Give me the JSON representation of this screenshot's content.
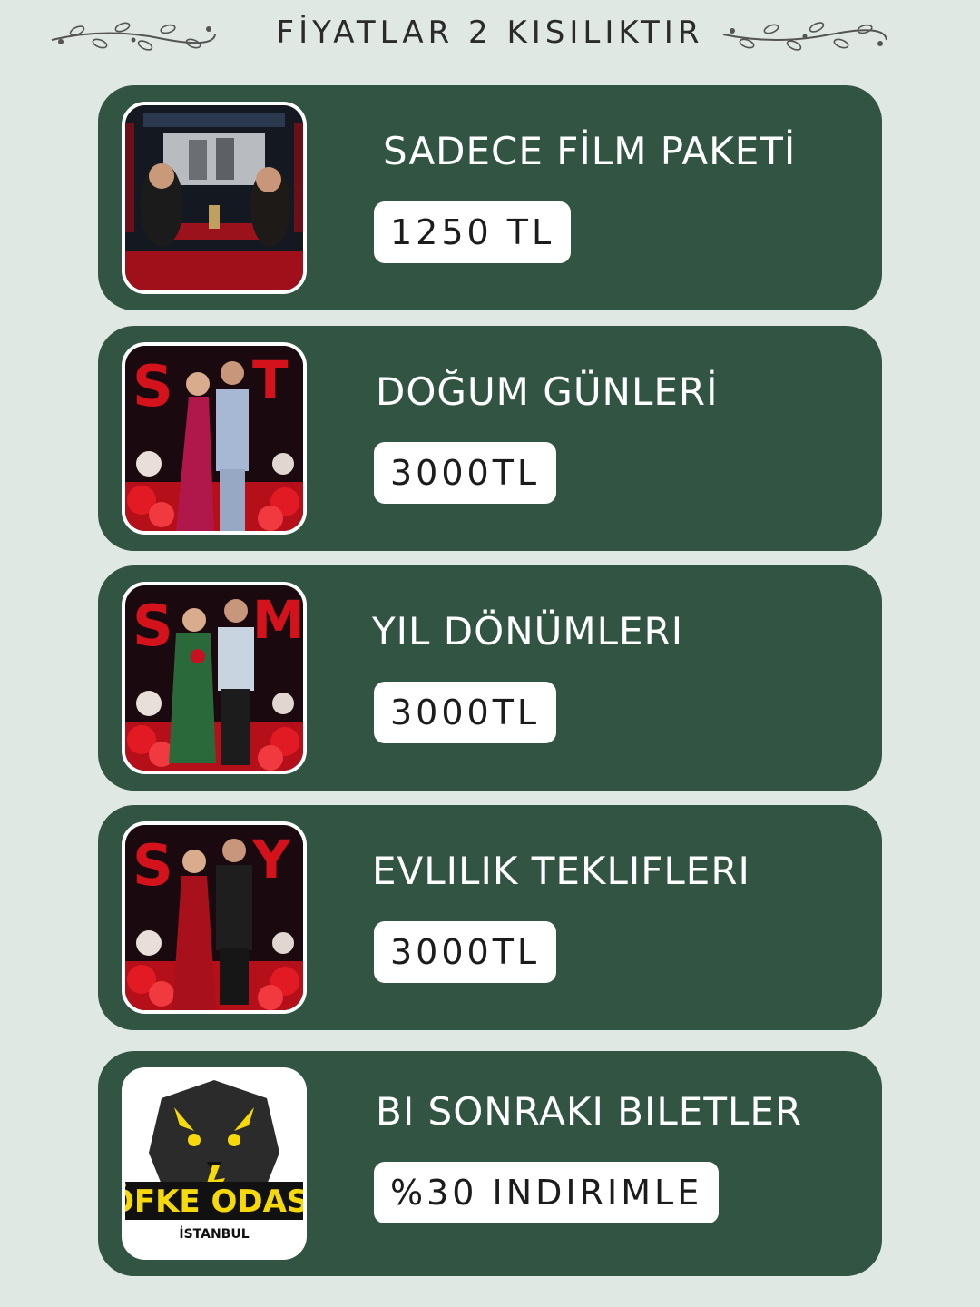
{
  "header": {
    "title": "FİYATLAR 2 KISILIKTIR"
  },
  "packages": [
    {
      "title": "SADECE FİLM PAKETİ",
      "price": "1250 TL",
      "image": "couple-cinema-photo"
    },
    {
      "title": "DOĞUM GÜNLERİ",
      "price": "3000TL",
      "image": "couple-balloons-photo"
    },
    {
      "title": "YIL DÖNÜMLERI",
      "price": "3000TL",
      "image": "couple-balloons-photo"
    },
    {
      "title": "EVLILIK TEKLIFLERI",
      "price": "3000TL",
      "image": "couple-balloons-photo"
    },
    {
      "title": "BI SONRAKI BILETLER",
      "price": "%30 INDIRIMLE",
      "image": "ofke-odasi-logo",
      "logo_text": "ÖFKE ODASI",
      "logo_subtext": "İSTANBUL"
    }
  ],
  "colors": {
    "background": "#dfe8e2",
    "card": "#315443",
    "price_bg": "#ffffff",
    "accent_red": "#d3121c",
    "logo_yellow": "#f5d90a"
  }
}
